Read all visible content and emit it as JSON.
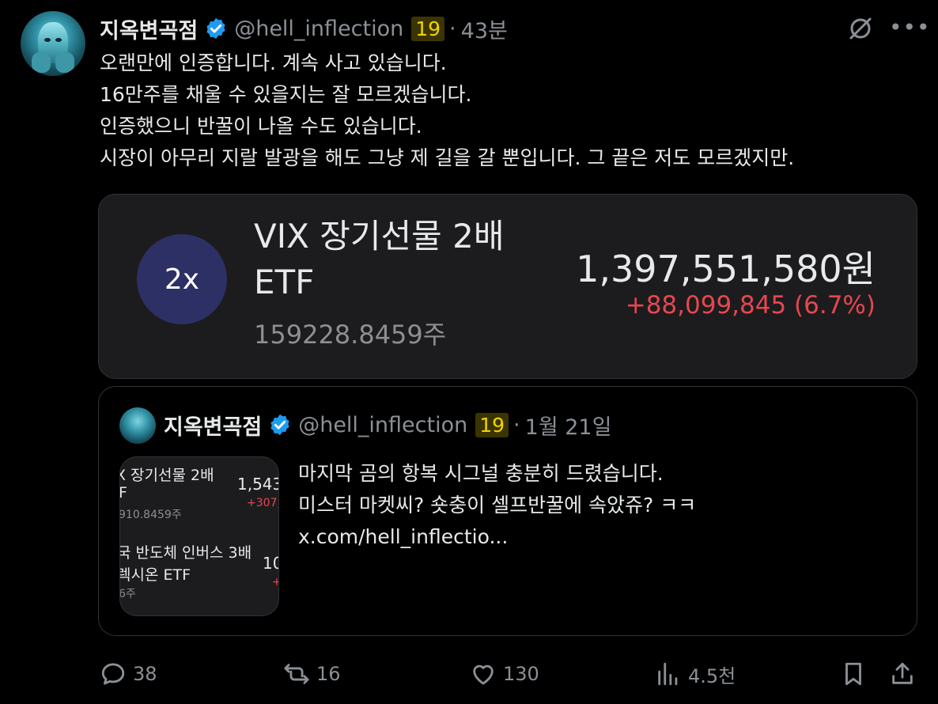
{
  "post": {
    "author_name": "지옥변곡점",
    "handle": "@hell_inflection",
    "badge": "19",
    "separator": "·",
    "time": "43분",
    "lines": [
      "오랜만에 인증합니다. 계속 사고 있습니다.",
      "16만주를 채울 수 있을지는 잘 모르겠습니다.",
      "인증했으니 반꿀이 나올 수도 있습니다.",
      "시장이 아무리 지랄 발광을 해도 그냥 제 길을 갈 뿐입니다. 그 끝은 저도 모르겠지만."
    ]
  },
  "card": {
    "leverage": "2x",
    "title": "VIX 장기선물 2배 ETF",
    "shares": "159228.8459주",
    "value": "1,397,551,580원",
    "change": "+88,099,845 (6.7%)"
  },
  "quote": {
    "author_name": "지옥변곡점",
    "handle": "@hell_inflection",
    "badge": "19",
    "separator": "·",
    "time": "1월 21일",
    "thumb": {
      "line1": "X 장기선물 2배",
      "line2": "F",
      "line3": "910.8459주",
      "val1": "1,543",
      "chg1": "+307,",
      "line4": "국 반도체 인버스 3배",
      "line5": "렉시온 ETF",
      "line6": "6주",
      "val2": "10",
      "chg2": "+"
    },
    "lines": [
      "마지막 곰의 항복 시그널 충분히 드렸습니다.",
      "미스터 마켓씨? 숏충이 셀프반꿀에 속았쥬? ㅋㅋ",
      "x.com/hell_inflectio..."
    ]
  },
  "actions": {
    "replies": "38",
    "reposts": "16",
    "likes": "130",
    "views": "4.5천"
  },
  "colors": {
    "background": "#000000",
    "text": "#e7e9ea",
    "muted": "#8b9096",
    "verified": "#1d9bf0",
    "negative_red": "#e6474f",
    "badge_bg": "#3a3500",
    "badge_fg": "#f2d300"
  }
}
